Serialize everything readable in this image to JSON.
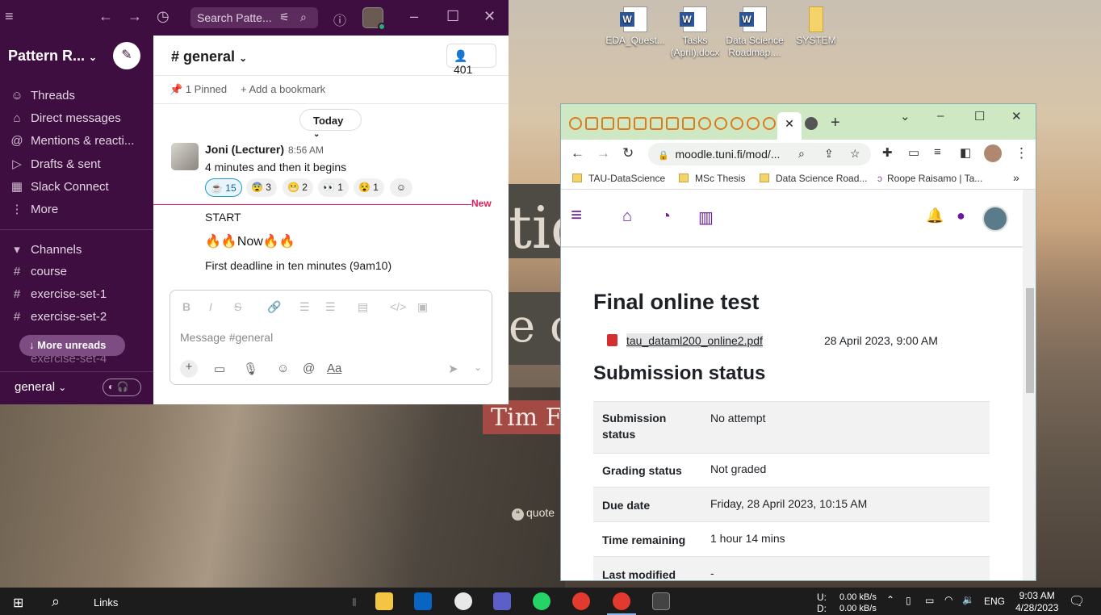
{
  "desktop": {
    "icons": [
      {
        "label": "EDA_Quest...",
        "type": "word"
      },
      {
        "label": "Tasks (April).docx",
        "type": "word"
      },
      {
        "label": "Data Science Roadmap....",
        "type": "word"
      },
      {
        "label": "SYSTEM",
        "type": "folder"
      }
    ],
    "quote_fragment_1": "tic",
    "quote_fragment_2": "e c",
    "quote_author": "Tim Fe",
    "quote_brand": "quote"
  },
  "slack": {
    "search_placeholder": "Search Patte...",
    "workspace_name": "Pattern R...",
    "nav": [
      "Threads",
      "Direct messages",
      "Mentions & reacti...",
      "Drafts & sent",
      "Slack Connect",
      "More"
    ],
    "channels_header": "Channels",
    "channels": [
      "course",
      "exercise-set-1",
      "exercise-set-2"
    ],
    "partial_channel": "exercise-set-4",
    "more_unreads": "More unreads",
    "footer_channel": "general",
    "channel_title": "# general",
    "member_count": "401",
    "pinned": "1 Pinned",
    "add_bookmark": "Add a bookmark",
    "today": "Today",
    "message": {
      "author": "Joni (Lecturer)",
      "time": "8:56 AM",
      "text": "4 minutes and then it begins",
      "reactions": [
        {
          "emoji": "☕",
          "count": "15"
        },
        {
          "emoji": "😨",
          "count": "3"
        },
        {
          "emoji": "😬",
          "count": "2"
        },
        {
          "emoji": "👀",
          "count": "1"
        },
        {
          "emoji": "😵",
          "count": "1"
        }
      ]
    },
    "new_label": "New",
    "followups": [
      "START",
      "🔥🔥Now🔥🔥",
      "First deadline in ten minutes (9am10)"
    ],
    "composer_placeholder": "Message #general"
  },
  "chrome": {
    "url": "moodle.tuni.fi/mod/...",
    "bookmarks": [
      "TAU-DataScience",
      "MSc Thesis",
      "Data Science Road...",
      "Roope Raisamo | Ta..."
    ],
    "page": {
      "title": "Final online test",
      "file_name": "tau_dataml200_online2.pdf",
      "file_date": "28 April 2023, 9:00 AM",
      "section_title": "Submission status",
      "rows": [
        {
          "key": "Submission status",
          "value": "No attempt"
        },
        {
          "key": "Grading status",
          "value": "Not graded"
        },
        {
          "key": "Due date",
          "value": "Friday, 28 April 2023, 10:15 AM"
        },
        {
          "key": "Time remaining",
          "value": "1 hour 14 mins"
        },
        {
          "key": "Last modified",
          "value": "-"
        }
      ]
    }
  },
  "taskbar": {
    "links_label": "Links",
    "net_up_label": "U:",
    "net_up": "0.00 kB/s",
    "net_down_label": "D:",
    "net_down": "0.00 kB/s",
    "lang": "ENG",
    "time": "9:03 AM",
    "date": "4/28/2023"
  }
}
